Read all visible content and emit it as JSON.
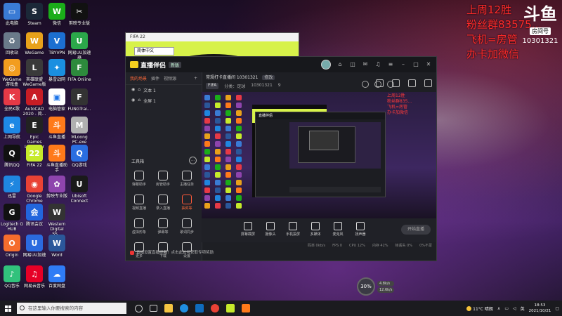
{
  "desktop": {
    "icons": [
      {
        "label": "此电脑",
        "color": "#3a7bd5",
        "glyph": "▭"
      },
      {
        "label": "Steam",
        "color": "#1b2838",
        "glyph": "S"
      },
      {
        "label": "微信",
        "color": "#1aad19",
        "glyph": "W"
      },
      {
        "label": "剪映专业版",
        "color": "#111111",
        "glyph": "✂"
      },
      {
        "label": "回收站",
        "color": "#6a7a8a",
        "glyph": "♻"
      },
      {
        "label": "WeGame",
        "color": "#e8a11a",
        "glyph": "W"
      },
      {
        "label": "TBYVPN",
        "color": "#1c6fd1",
        "glyph": "V"
      },
      {
        "label": "网易UU加速器",
        "color": "#2ba84a",
        "glyph": "U"
      },
      {
        "label": "WeGame\n游戏盒",
        "color": "#f29d1f",
        "glyph": "◎"
      },
      {
        "label": "英雄联盟\nWeGame版",
        "color": "#3a3a3a",
        "glyph": "L"
      },
      {
        "label": "暴雪战网",
        "color": "#1a8fe0",
        "glyph": "✦"
      },
      {
        "label": "FIFA Online",
        "color": "#2d8a3c",
        "glyph": "F"
      },
      {
        "label": "全民K歌",
        "color": "#e63946",
        "glyph": "K"
      },
      {
        "label": "AutoCAD\n2020 - 简...",
        "color": "#c81d25",
        "glyph": "A"
      },
      {
        "label": "电脑管家",
        "color": "#ffffff",
        "glyph": "▣"
      },
      {
        "label": "FUNGTrai...",
        "color": "#333333",
        "glyph": "F"
      },
      {
        "label": "上网导航",
        "color": "#1e88e5",
        "glyph": "e"
      },
      {
        "label": "Epic Games\nLauncher",
        "color": "#222222",
        "glyph": "E"
      },
      {
        "label": "斗鱼直播",
        "color": "#ff7a1a",
        "glyph": "斗"
      },
      {
        "label": "MLoong\nPC.exe",
        "color": "#b0b0b0",
        "glyph": "M"
      },
      {
        "label": "腾讯QQ",
        "color": "#111111",
        "glyph": "Q"
      },
      {
        "label": "FIFA 22",
        "color": "#c6ea2b",
        "glyph": "22"
      },
      {
        "label": "斗鱼直播助手",
        "color": "#ff7a1a",
        "glyph": "斗"
      },
      {
        "label": "QQ游戏",
        "color": "#2a6ee0",
        "glyph": "Q"
      },
      {
        "label": "迅雷",
        "color": "#1f86e0",
        "glyph": "⚡"
      },
      {
        "label": "Google\nChrome",
        "color": "#e94235",
        "glyph": "◉"
      },
      {
        "label": "剪映专业版",
        "color": "#8e44ad",
        "glyph": "✿"
      },
      {
        "label": "Ubisoft\nConnect",
        "color": "#1a1a1a",
        "glyph": "U"
      },
      {
        "label": "Logitech G\nHUB",
        "color": "#111111",
        "glyph": "G"
      },
      {
        "label": "腾讯会议",
        "color": "#2266dd",
        "glyph": "会"
      },
      {
        "label": "Western\nDigital SS...",
        "color": "#333333",
        "glyph": "W"
      },
      {
        "label": "Origin",
        "color": "#f56c2d",
        "glyph": "O"
      },
      {
        "label": "网易UU加速",
        "color": "#2b6adf",
        "glyph": "U"
      },
      {
        "label": "Word",
        "color": "#2b579a",
        "glyph": "W"
      },
      {
        "label": "QQ音乐",
        "color": "#31c27c",
        "glyph": "♪"
      },
      {
        "label": "网易云音乐",
        "color": "#e60026",
        "glyph": "♫"
      },
      {
        "label": "百度网盘",
        "color": "#2f7cf6",
        "glyph": "☁"
      }
    ]
  },
  "overlay": {
    "line1": "上周12胜",
    "line2": "粉丝群83575...",
    "line3": "飞机=房管",
    "line4": "办卡加微信",
    "brand": "斗鱼",
    "room_label": "房间号",
    "room_number": "10301321"
  },
  "fifa_window": {
    "title": "FIFA 22",
    "language": "简体中文"
  },
  "app": {
    "name": "直播伴侣",
    "version": "新版",
    "sidebar": {
      "tabs": [
        "我的场景",
        "插件",
        "视频源"
      ],
      "add": "+",
      "scenes": [
        "文本 1",
        "全屏 1"
      ],
      "tools_title": "工具箱",
      "tools": [
        {
          "label": "弹幕助手",
          "red": false
        },
        {
          "label": "房管助手",
          "red": false
        },
        {
          "label": "主播任务",
          "red": false
        },
        {
          "label": "视频直播",
          "red": false
        },
        {
          "label": "录入直播",
          "red": false
        },
        {
          "label": "抽奖等",
          "red": true
        },
        {
          "label": "虚拟形象",
          "red": false
        },
        {
          "label": "弹幕等",
          "red": false
        },
        {
          "label": "歌词同步",
          "red": false
        },
        {
          "label": "更多",
          "red": false
        },
        {
          "label": "下载",
          "red": false
        },
        {
          "label": "设置",
          "red": false
        }
      ],
      "notice": "直播设置直播提醒！点击此处可获取专项奖励"
    },
    "room": {
      "title": "常规打卡直播间 10301321",
      "tag": "修改",
      "game": "FIFA",
      "category": "分类：足球",
      "id": "10301321",
      "fans": "9"
    },
    "controls": [
      {
        "label": "屏幕截屏"
      },
      {
        "label": "摄像头"
      },
      {
        "label": "手机投屏"
      },
      {
        "label": "多媒体"
      },
      {
        "label": "麦克风"
      },
      {
        "label": "扬声器"
      }
    ],
    "start_live": "开始直播",
    "status": [
      "码率 0kb/s",
      "FPS 0",
      "CPU 12%",
      "内存 42%",
      "帧丢失 0%",
      "0%不足"
    ]
  },
  "preview_overlay": {
    "text": "上周12胜\n粉丝群835...\n飞机=房管\n办卡加微信"
  },
  "perf_widget": {
    "percent": "30%",
    "up": "4.8k/s",
    "down": "12.6k/s"
  },
  "taskbar": {
    "search_placeholder": "在这里输入你要搜索的内容",
    "weather": "11°C 晴朗",
    "time": "18:53",
    "date": "2021/10/21",
    "lang": "英"
  }
}
